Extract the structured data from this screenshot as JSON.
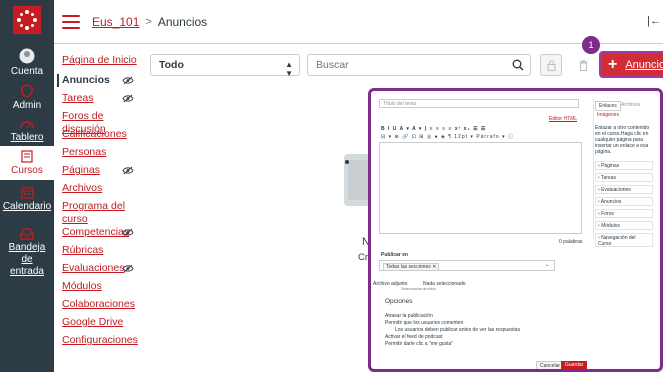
{
  "gnav": {
    "items": [
      {
        "label": "Cuenta",
        "icon": "account-icon"
      },
      {
        "label": "Admin",
        "icon": "admin-shield-icon"
      },
      {
        "label": "Tablero",
        "icon": "dashboard-icon"
      },
      {
        "label": "Cursos",
        "icon": "courses-book-icon"
      },
      {
        "label": "Calendario",
        "icon": "calendar-icon"
      },
      {
        "label": "Bandeja de entrada",
        "icon": "inbox-icon"
      }
    ]
  },
  "header": {
    "course": "Eus_101",
    "separator": ">",
    "page": "Anuncios",
    "collapse_glyph": "|←"
  },
  "course_nav": [
    {
      "label": "Página de Inicio",
      "hidden": false,
      "active": false
    },
    {
      "label": "Anuncios",
      "hidden": true,
      "active": true
    },
    {
      "label": "Tareas",
      "hidden": true,
      "active": false
    },
    {
      "label": "Foros de discusión",
      "hidden": false,
      "active": false
    },
    {
      "label": "Calificaciones",
      "hidden": false,
      "active": false
    },
    {
      "label": "Personas",
      "hidden": false,
      "active": false
    },
    {
      "label": "Páginas",
      "hidden": true,
      "active": false
    },
    {
      "label": "Archivos",
      "hidden": false,
      "active": false
    },
    {
      "label": "Programa del curso",
      "hidden": false,
      "active": false
    },
    {
      "label": "Competencias",
      "hidden": true,
      "active": false
    },
    {
      "label": "Rúbricas",
      "hidden": false,
      "active": false
    },
    {
      "label": "Evaluaciones",
      "hidden": true,
      "active": false
    },
    {
      "label": "Módulos",
      "hidden": false,
      "active": false
    },
    {
      "label": "Colaboraciones",
      "hidden": false,
      "active": false
    },
    {
      "label": "Google Drive",
      "hidden": false,
      "active": false
    },
    {
      "label": "Configuraciones",
      "hidden": false,
      "active": false
    }
  ],
  "toolbar": {
    "filter_value": "Todo",
    "search_placeholder": "Buscar",
    "badge": "1",
    "add_label": "Anuncio"
  },
  "empty_state": {
    "title_fragment": "N",
    "text_fragment": "Cre"
  },
  "overlay": {
    "title_placeholder": "Título del tema",
    "html_editor": "Editor HTML",
    "toolbar_row1": "B I U A ▾ A ▾ I̲ ≡ ≡ ≡ ≡ x² x₂ ☰ ☰",
    "toolbar_row2": "⊟ ▾ ⊕ 🔗 ⊡ ⊞ ◎ ● ◈ ¶ 12pt ▾ Párrafo ▾ ⓘ",
    "word_count": "0 palabras",
    "publish_in": "Publicar en",
    "section_chip": "Todas las secciones ✕",
    "attachment_label": "Archivo adjunto",
    "file_button": "Seleccionar archivo",
    "no_file": "Nada seleccionado",
    "options_heading": "Opciones",
    "options": [
      "Atrasar la publicación",
      "Permitir que los usuarios comenten",
      "Los usuarios deben publicar antes de ver las respuestas",
      "Activar el feed de podcast",
      "Permitir darle clic a \"me gusta\""
    ],
    "cancel": "Cancelar",
    "save": "Guardar",
    "side_tabs": [
      "Enlaces",
      "Archivos"
    ],
    "images_link": "Imágenes",
    "side_help": "Enlazar a otro contenido en el curso.Haga clic en cualquier página para insertar un enlace a esa página.",
    "side_items": [
      "Páginas",
      "Tareas",
      "Evaluaciones",
      "Anuncios",
      "Foros",
      "Módulos",
      "Navegación del Curso"
    ]
  },
  "colors": {
    "brand": "#c41c22",
    "nav_bg": "#2d3b45",
    "highlight": "#7d2c8a"
  }
}
